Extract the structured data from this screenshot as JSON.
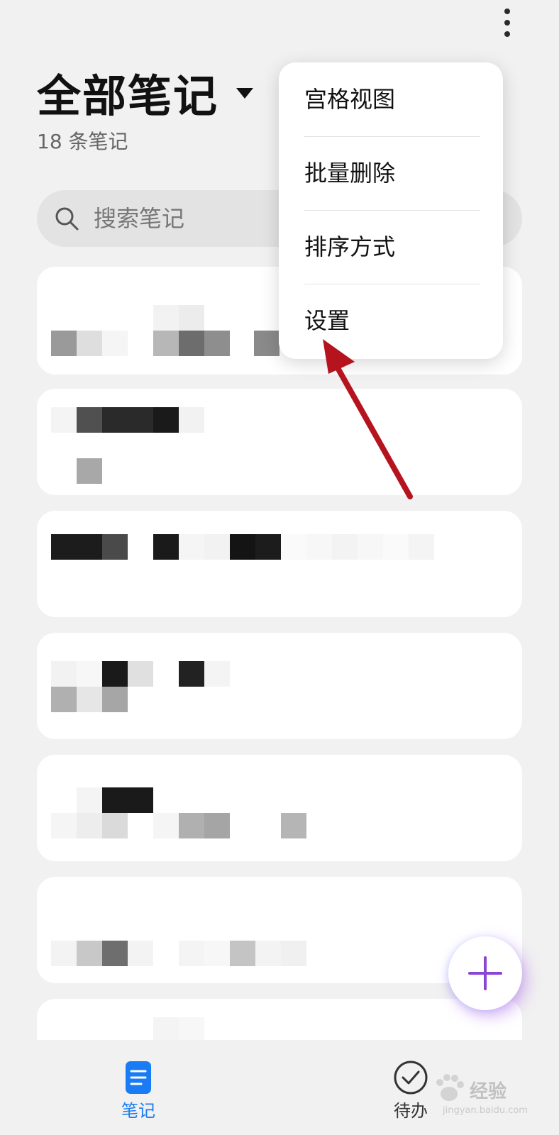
{
  "header": {
    "title": "全部笔记",
    "count": "18 条笔记",
    "more_icon": "more-vertical-icon"
  },
  "search": {
    "placeholder": "搜索笔记",
    "icon": "search-icon"
  },
  "notes": {
    "items": [
      "note-1",
      "note-2",
      "note-3",
      "note-4",
      "note-5",
      "note-6",
      "note-7"
    ],
    "content_blurred": true
  },
  "menu": {
    "items": [
      {
        "label": "宫格视图"
      },
      {
        "label": "批量删除"
      },
      {
        "label": "排序方式"
      },
      {
        "label": "设置"
      }
    ],
    "highlighted": "设置"
  },
  "fab": {
    "icon": "plus-icon"
  },
  "bottom_nav": {
    "items": [
      {
        "label": "笔记",
        "icon": "note-icon",
        "active": true
      },
      {
        "label": "待办",
        "icon": "check-circle-icon",
        "active": false
      }
    ]
  },
  "watermark": {
    "text": "经验",
    "sub": "jingyan.baidu.com"
  },
  "colors": {
    "accent": "#1a7cf5",
    "fab_plus": "#8a45d6",
    "annotation": "#b5141f",
    "background": "#f1f1f1"
  }
}
